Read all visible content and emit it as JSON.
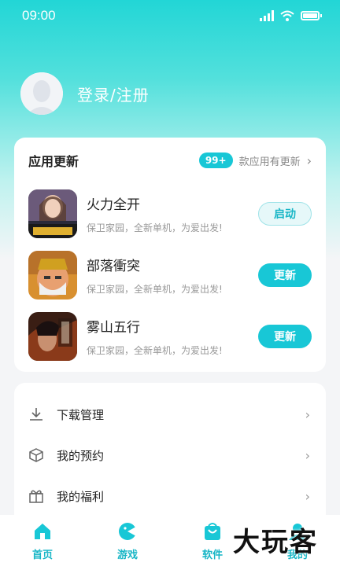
{
  "status_bar": {
    "time": "09:00"
  },
  "profile": {
    "login_text": "登录/注册"
  },
  "updates": {
    "title": "应用更新",
    "badge": "99+",
    "summary": "款应用有更新",
    "apps": [
      {
        "name": "火力全开",
        "desc": "保卫家园，全新单机，为爱出发!",
        "action": "启动"
      },
      {
        "name": "部落衝突",
        "desc": "保卫家园，全新单机，为爱出发!",
        "action": "更新"
      },
      {
        "name": "雾山五行",
        "desc": "保卫家园，全新单机，为爱出发!",
        "action": "更新"
      }
    ]
  },
  "menu": {
    "items": [
      {
        "label": "下载管理",
        "icon": "download-icon"
      },
      {
        "label": "我的预约",
        "icon": "box-icon"
      },
      {
        "label": "我的福利",
        "icon": "gift-icon"
      }
    ]
  },
  "tabbar": {
    "tabs": [
      {
        "label": "首页",
        "icon": "home-icon"
      },
      {
        "label": "游戏",
        "icon": "game-icon"
      },
      {
        "label": "软件",
        "icon": "bag-icon"
      },
      {
        "label": "我的",
        "icon": "user-icon"
      }
    ]
  },
  "watermark": {
    "text": "大玩客"
  },
  "colors": {
    "accent": "#18c7d6",
    "header_gradient_top": "#22d6d6"
  }
}
